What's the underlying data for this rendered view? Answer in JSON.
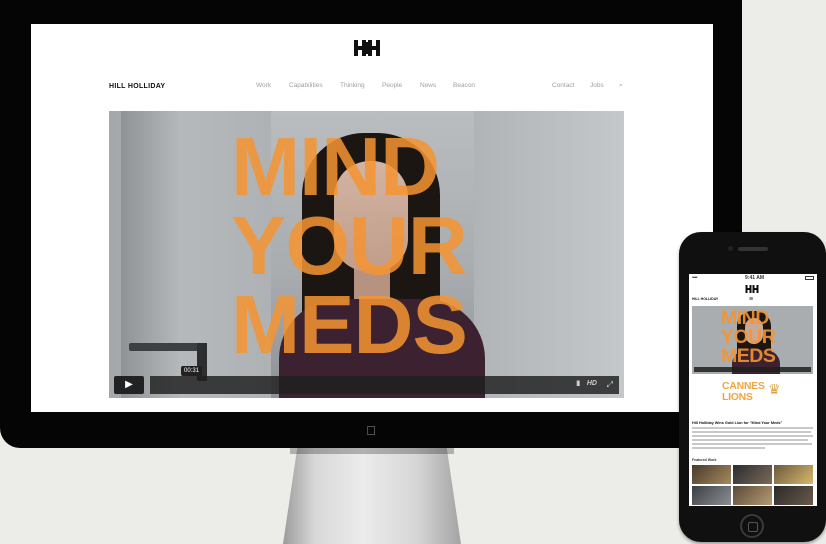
{
  "site": {
    "brand": "HILL HOLLIDAY",
    "nav_main": [
      "Work",
      "Capabilities",
      "Thinking",
      "People",
      "News",
      "Beacon"
    ],
    "nav_right": [
      "Contact",
      "Jobs"
    ],
    "search_icon": "⌕"
  },
  "hero": {
    "title_lines": [
      "MIND",
      "YOUR",
      "MEDS"
    ],
    "video": {
      "play_icon": "▶",
      "time": "00:31",
      "volume_icon": "lllll",
      "hd_label": "HD",
      "fullscreen_icon": "⤢"
    }
  },
  "mobile": {
    "status_carrier": "•••• ",
    "status_time": "9:41 AM",
    "brand": "HILL HOLLIDAY",
    "menu_icon": "≡",
    "hero_title_lines": [
      "MIND",
      "YOUR",
      "MEDS"
    ],
    "cannes_line1": "CANNES",
    "cannes_line2": "LIONS",
    "headline": "Hill Holliday Wins Gold Lion for \"Mind Your Meds\"",
    "featured_label": "Featured Work"
  },
  "device_logo": "",
  "colors": {
    "hero_text": "#F59432",
    "cannes": "#F0A640",
    "nav_text": "#A0A0A0"
  }
}
